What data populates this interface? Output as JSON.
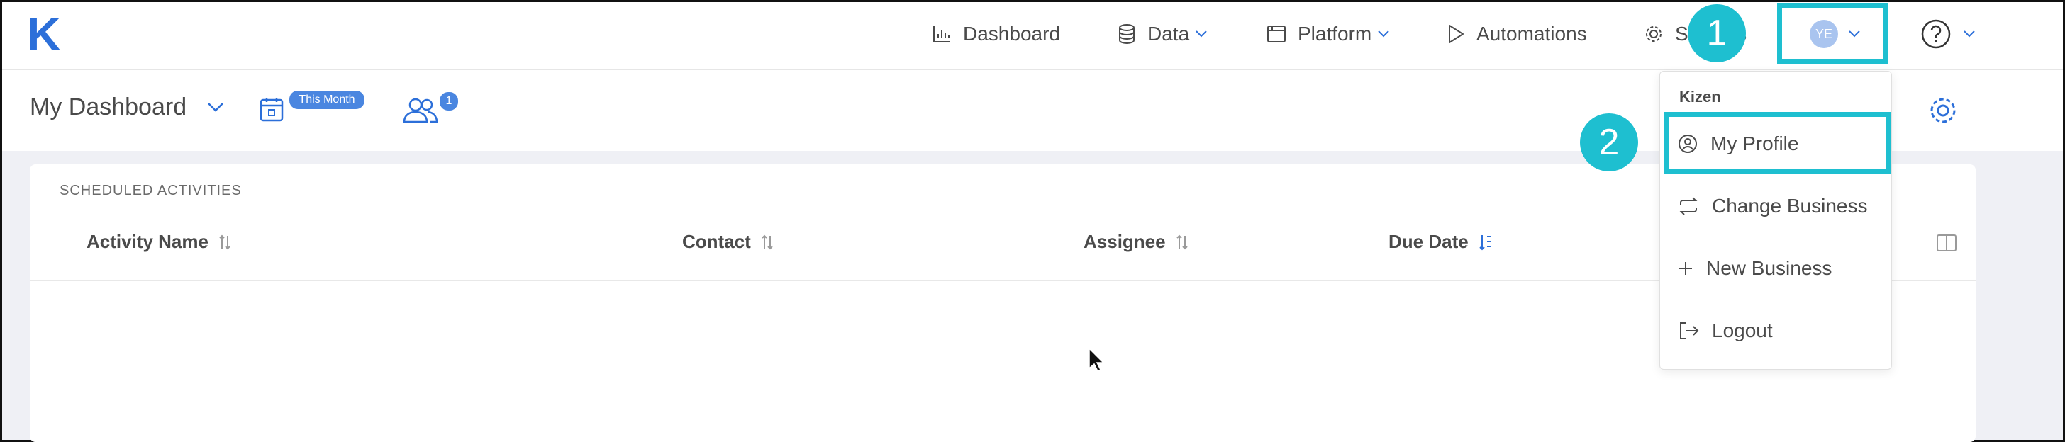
{
  "app": {
    "logo": "K"
  },
  "nav": {
    "dashboard": "Dashboard",
    "data": "Data",
    "platform": "Platform",
    "automations": "Automations",
    "settings": "Settings",
    "avatar_initials": "YE"
  },
  "toolbar": {
    "title": "My Dashboard",
    "date_badge": "This Month",
    "team_count": "1"
  },
  "table": {
    "section_title": "SCHEDULED ACTIVITIES",
    "columns": [
      "Activity Name",
      "Contact",
      "Assignee",
      "Due Date"
    ]
  },
  "user_menu": {
    "header": "Kizen",
    "items": [
      "My Profile",
      "Change Business",
      "New Business",
      "Logout"
    ]
  },
  "annotations": {
    "step1": "1",
    "step2": "2"
  },
  "colors": {
    "accent": "#2c6fd9",
    "highlight": "#1ebfd0",
    "background": "#eff0f5"
  }
}
